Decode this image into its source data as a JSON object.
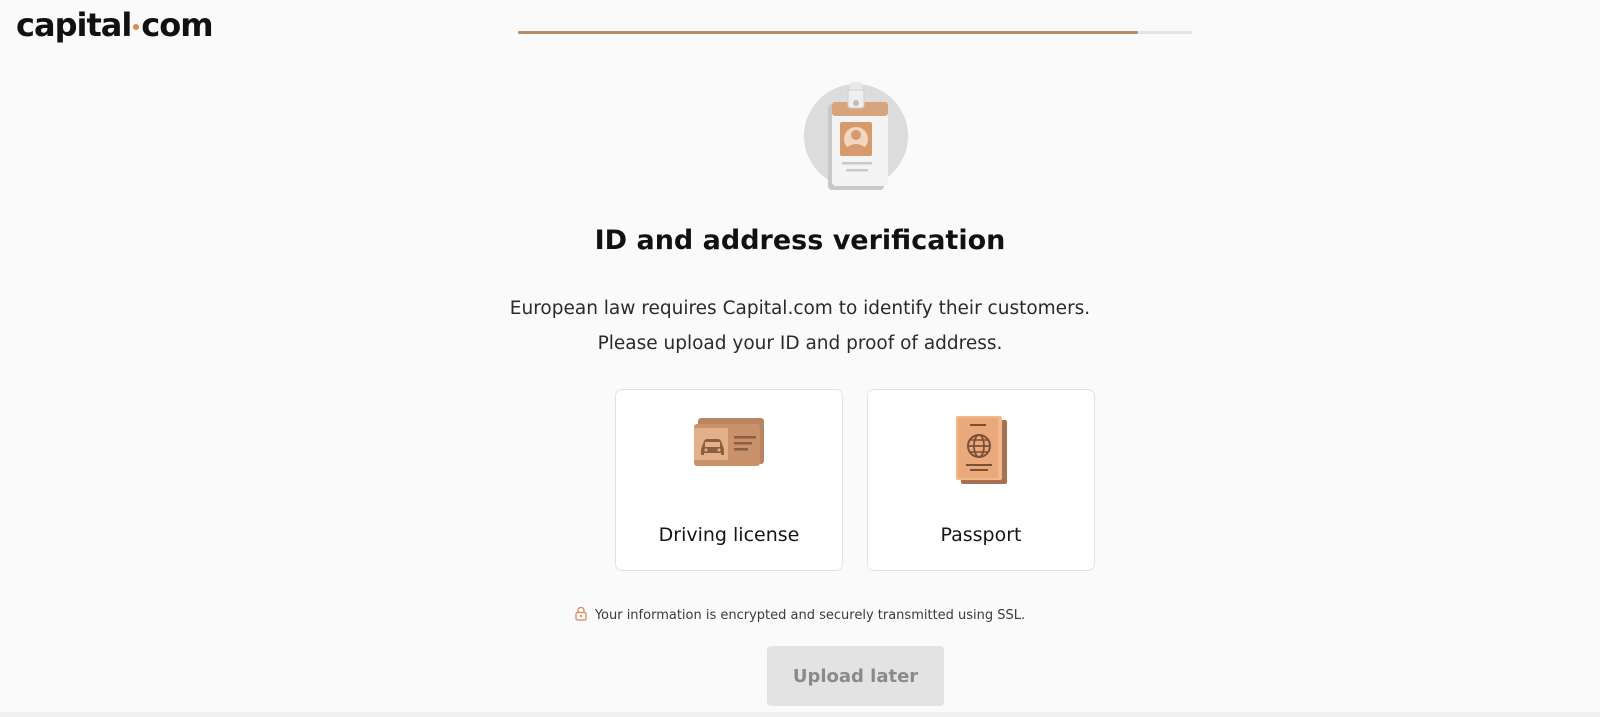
{
  "brand": {
    "logo_left": "capital",
    "logo_right": "com",
    "accent_color": "#e0894d"
  },
  "progress": {
    "fraction": 0.92
  },
  "header": {
    "icon": "id-badge-icon",
    "title": "ID and address verification"
  },
  "description": {
    "line1": "European law requires Capital.com to identify their customers.",
    "line2": "Please upload your ID and proof of address."
  },
  "options": [
    {
      "label": "Driving license",
      "icon": "driving-license-icon"
    },
    {
      "label": "Passport",
      "icon": "passport-icon"
    }
  ],
  "security": {
    "icon": "lock-icon",
    "text": "Your information is encrypted and securely transmitted using SSL."
  },
  "actions": {
    "upload_later": "Upload later"
  }
}
